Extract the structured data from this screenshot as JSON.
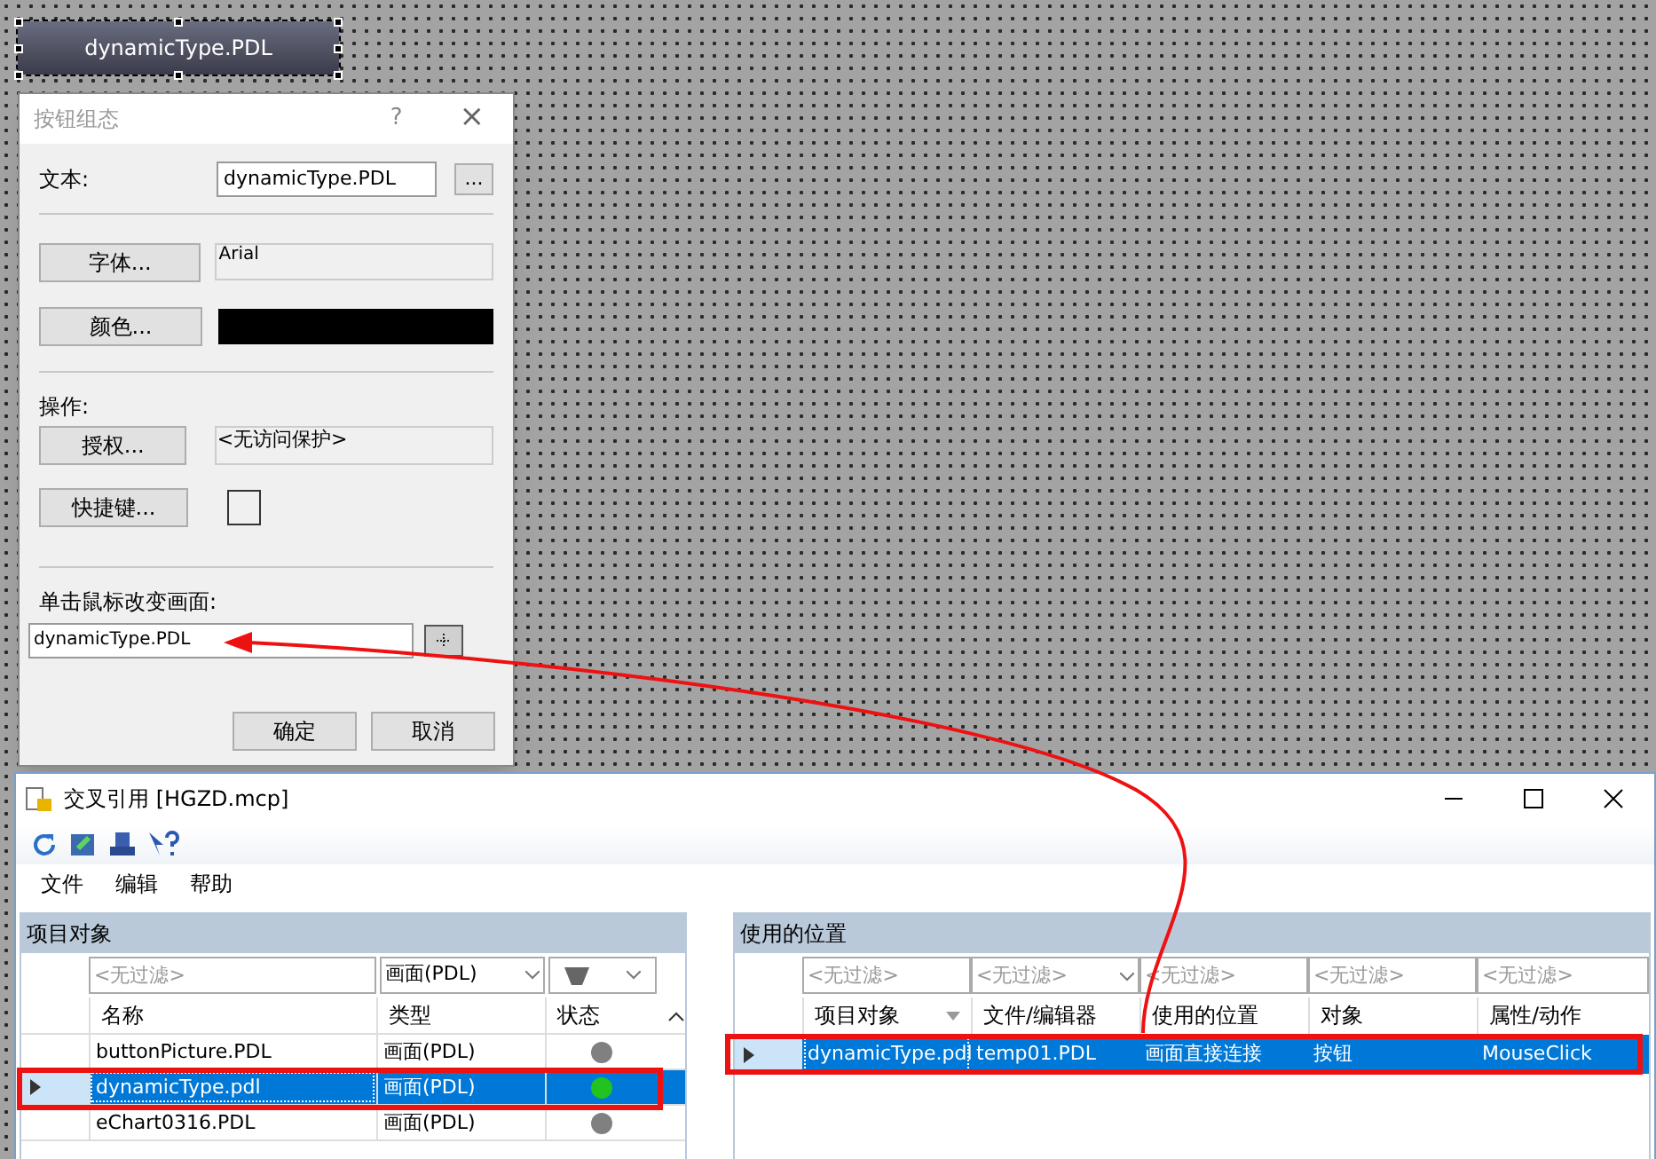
{
  "canvas_button": {
    "label": "dynamicType.PDL",
    "selected": true
  },
  "dialog": {
    "title": "按钮组态",
    "help": "?",
    "close": "×",
    "text_label": "文本:",
    "text_value": "dynamicType.PDL",
    "browse": "...",
    "font_button": "字体...",
    "font_value": "Arial",
    "color_button": "颜色...",
    "color": "#000000",
    "operation_label": "操作:",
    "auth_button": "授权...",
    "auth_value": "<无访问保护>",
    "hotkey_button": "快捷键...",
    "hotkey_checked": false,
    "change_label": "单击鼠标改变画面:",
    "change_value": "dynamicType.PDL",
    "ok": "确定",
    "cancel": "取消"
  },
  "crossref": {
    "title": "交叉引用 [HGZD.mcp]",
    "menu": [
      "文件",
      "编辑",
      "帮助"
    ],
    "left": {
      "header": "项目对象",
      "filters": [
        "<无过滤>",
        "画面(PDL)"
      ],
      "columns": [
        "名称",
        "类型",
        "状态"
      ],
      "rows": [
        {
          "name": "buttonPicture.PDL",
          "type": "画面(PDL)",
          "color": "#808080",
          "selected": false
        },
        {
          "name": "dynamicType.pdl",
          "type": "画面(PDL)",
          "color": "#22c21f",
          "selected": true
        },
        {
          "name": "eChart0316.PDL",
          "type": "画面(PDL)",
          "color": "#808080",
          "selected": false
        }
      ]
    },
    "right": {
      "header": "使用的位置",
      "filters": [
        "<无过滤>",
        "<无过滤>",
        "<无过滤>",
        "<无过滤>",
        "<无过滤>"
      ],
      "columns": [
        "项目对象",
        "文件/编辑器",
        "使用的位置",
        "对象",
        "属性/动作"
      ],
      "rows": [
        {
          "cells": [
            "dynamicType.pdl",
            "temp01.PDL",
            "画面直接连接",
            "按钮",
            "MouseClick"
          ],
          "selected": true
        }
      ]
    }
  }
}
